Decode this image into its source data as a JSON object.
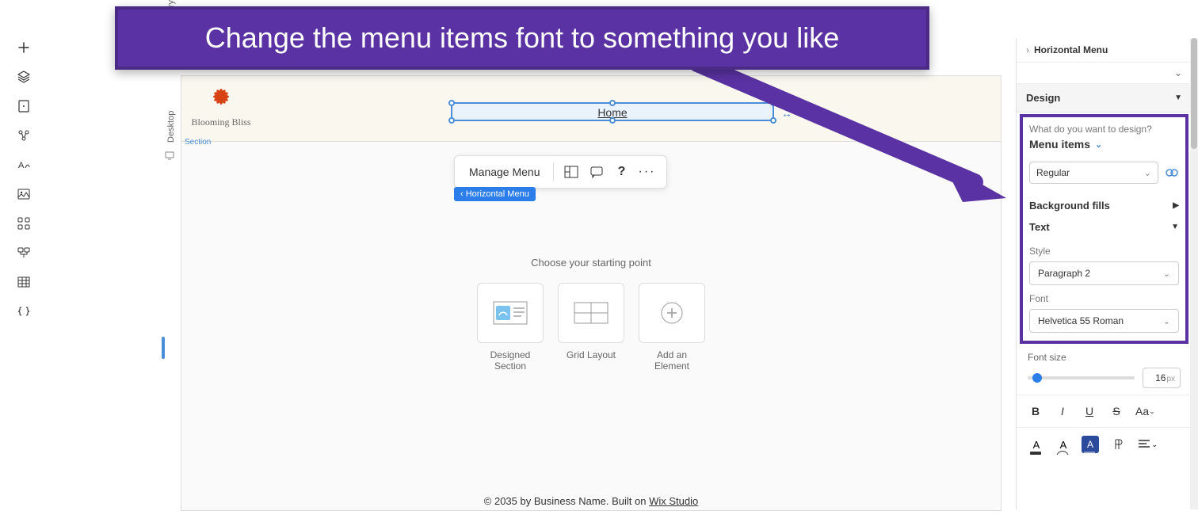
{
  "overlay": {
    "text": "Change the menu items font to something you like"
  },
  "left_tools": [
    "add",
    "layers",
    "page",
    "links",
    "text-theme",
    "media",
    "apps",
    "cms",
    "grid",
    "code"
  ],
  "desktop_label": "Desktop  (Primary)",
  "desktop_word": "Desktop",
  "canvas": {
    "brand": "Blooming Bliss",
    "section_label": "Section",
    "menu_item": "Home",
    "toolbar": {
      "manage": "Manage Menu"
    },
    "tag": "‹ Horizontal Menu",
    "starting_point": "Choose your starting point",
    "cards": [
      {
        "label": "Designed Section"
      },
      {
        "label": "Grid Layout"
      },
      {
        "label": "Add an Element"
      }
    ],
    "footer_prefix": "© 2035 by Business Name. Built on ",
    "footer_link": "Wix Studio"
  },
  "right": {
    "breadcrumb": "Horizontal Menu",
    "design": "Design",
    "question": "What do you want to design?",
    "menu_items": "Menu items",
    "state": "Regular",
    "bg_fills": "Background fills",
    "text": "Text",
    "style_label": "Style",
    "style_value": "Paragraph 2",
    "font_label": "Font",
    "font_value": "Helvetica 55 Roman",
    "font_size_label": "Font size",
    "font_size_value": "16",
    "font_size_unit": "px"
  }
}
